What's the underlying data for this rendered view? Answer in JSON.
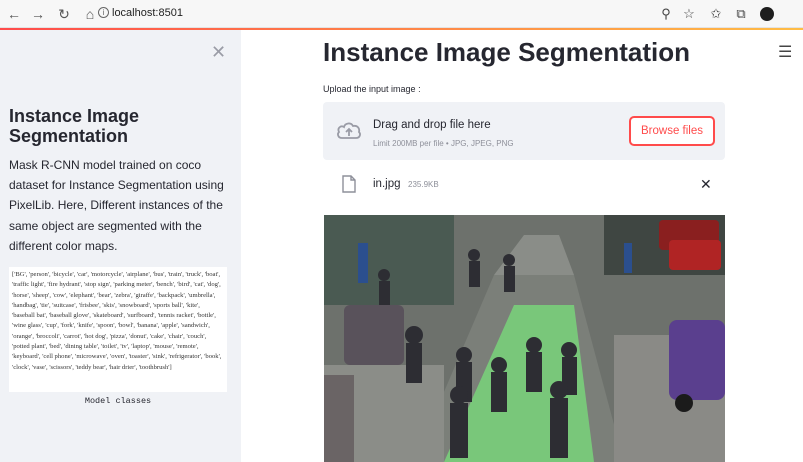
{
  "browser": {
    "url": "localhost:8501",
    "nav_icons": [
      "back-arrow-icon",
      "forward-arrow-icon",
      "reload-icon",
      "home-icon"
    ],
    "toolbar_icons": [
      "zoom-icon",
      "favorite-star-icon",
      "favorites-list-icon",
      "collections-icon",
      "profile-avatar"
    ]
  },
  "sidebar": {
    "title": "Instance Image Segmentation",
    "description": "Mask R-CNN model trained on coco dataset for Instance Segmentation using PixelLib. Here, Different instances of the same object are segmented with the different color maps.",
    "classes_text": "['BG', 'person', 'bicycle', 'car', 'motorcycle', 'airplane', 'bus', 'train', 'truck', 'boat', 'traffic light', 'fire hydrant', 'stop sign', 'parking meter', 'bench', 'bird', 'cat', 'dog', 'horse', 'sheep', 'cow', 'elephant', 'bear', 'zebra', 'giraffe', 'backpack', 'umbrella', 'handbag', 'tie', 'suitcase', 'frisbee', 'skis', 'snowboard', 'sports ball', 'kite', 'baseball bat', 'baseball glove', 'skateboard', 'surfboard', 'tennis racket', 'bottle', 'wine glass', 'cup', 'fork', 'knife', 'spoon', 'bowl', 'banana', 'apple', 'sandwich', 'orange', 'broccoli', 'carrot', 'hot dog', 'pizza', 'donut', 'cake', 'chair', 'couch', 'potted plant', 'bed', 'dining table', 'toilet', 'tv', 'laptop', 'mouse', 'remote', 'keyboard', 'cell phone', 'microwave', 'oven', 'toaster', 'sink', 'refrigerator', 'book', 'clock', 'vase', 'scissors', 'teddy bear', 'hair drier', 'toothbrush']",
    "classes_caption": "Model classes"
  },
  "main": {
    "title": "Instance Image Segmentation",
    "upload_label": "Upload the input image :",
    "dropzone": {
      "title": "Drag and drop file here",
      "subtitle": "Limit 200MB per file • JPG, JPEG, PNG",
      "button": "Browse files"
    },
    "file": {
      "name": "in.jpg",
      "size": "235.9KB"
    }
  },
  "colors": {
    "accent": "#ff4b4b",
    "sidebar_bg": "#f0f2f6",
    "text": "#262730"
  }
}
